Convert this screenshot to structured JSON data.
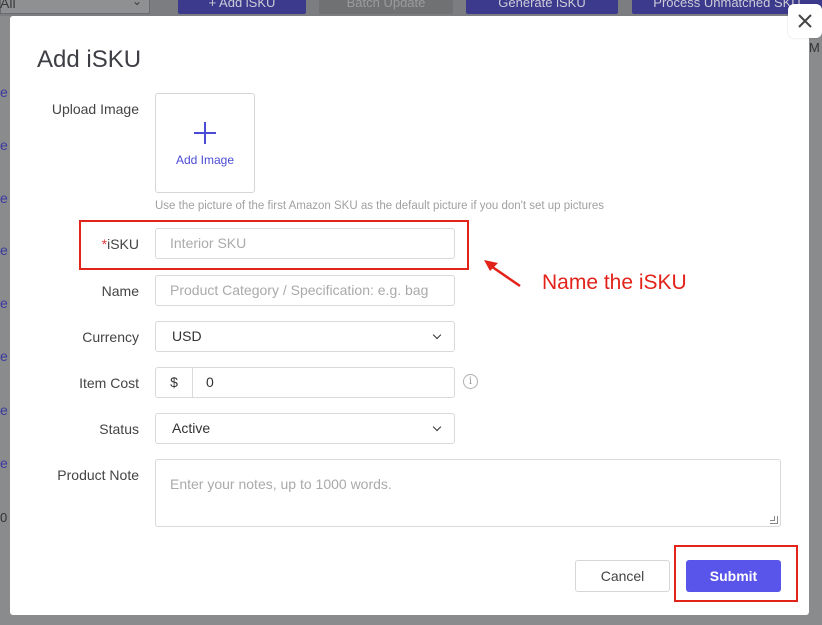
{
  "background": {
    "filter_select": "All",
    "buttons": [
      "+ Add iSKU",
      "Batch Update",
      "Generate iSKU",
      "Process Unmatched SKU"
    ],
    "row_links": [
      "e",
      "e",
      "e",
      "e",
      "e",
      "e",
      "e",
      "e"
    ],
    "right_header": "M",
    "left_number": "0"
  },
  "modal": {
    "title": "Add iSKU",
    "close_icon": "close-icon",
    "upload": {
      "label": "Upload Image",
      "button_text": "Add Image",
      "hint": "Use the picture of the first Amazon SKU as the default picture if you don't set up pictures"
    },
    "isku": {
      "required_mark": "*",
      "label": "iSKU",
      "placeholder": "Interior SKU",
      "value": ""
    },
    "name": {
      "label": "Name",
      "placeholder": "Product Category / Specification: e.g. bag",
      "value": ""
    },
    "currency": {
      "label": "Currency",
      "value": "USD"
    },
    "item_cost": {
      "label": "Item Cost",
      "prefix": "$",
      "value": "0"
    },
    "status": {
      "label": "Status",
      "value": "Active"
    },
    "product_note": {
      "label": "Product Note",
      "placeholder": "Enter your notes, up to 1000 words."
    },
    "cancel_label": "Cancel",
    "submit_label": "Submit"
  },
  "annotation": {
    "text": "Name the iSKU",
    "color": "#e2231a"
  },
  "colors": {
    "accent": "#5a55ea",
    "required": "#e23b3b"
  }
}
